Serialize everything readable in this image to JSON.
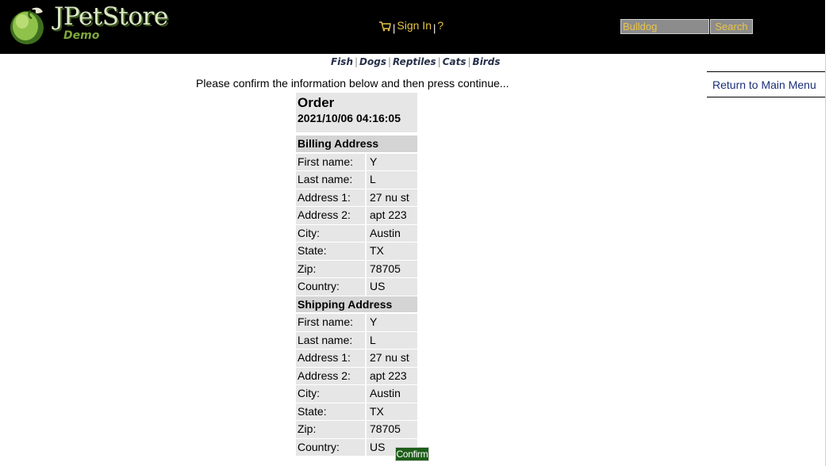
{
  "header": {
    "logo_title": "JPetStore",
    "logo_subtitle": "Demo",
    "sign_in": "Sign In",
    "help": "?",
    "search_value": "Bulldog",
    "search_button": "Search"
  },
  "quicklinks": [
    "Fish",
    "Dogs",
    "Reptiles",
    "Cats",
    "Birds"
  ],
  "return_link": "Return to Main Menu",
  "confirm_message": "Please confirm the information below and then press continue...",
  "order": {
    "title": "Order",
    "date": "2021/10/06 04:16:05",
    "billing_title": "Billing Address",
    "billing": [
      {
        "label": "First name:",
        "value": "Y"
      },
      {
        "label": "Last name:",
        "value": "L"
      },
      {
        "label": "Address 1:",
        "value": "27 nu st"
      },
      {
        "label": "Address 2:",
        "value": "apt 223"
      },
      {
        "label": "City:",
        "value": "Austin"
      },
      {
        "label": "State:",
        "value": "TX"
      },
      {
        "label": "Zip:",
        "value": "78705"
      },
      {
        "label": "Country:",
        "value": "US"
      }
    ],
    "shipping_title": "Shipping Address",
    "shipping": [
      {
        "label": "First name:",
        "value": "Y"
      },
      {
        "label": "Last name:",
        "value": "L"
      },
      {
        "label": "Address 1:",
        "value": "27 nu st"
      },
      {
        "label": "Address 2:",
        "value": "apt 223"
      },
      {
        "label": "City:",
        "value": "Austin"
      },
      {
        "label": "State:",
        "value": "TX"
      },
      {
        "label": "Zip:",
        "value": "78705"
      },
      {
        "label": "Country:",
        "value": "US"
      }
    ]
  },
  "confirm_button": "Confirm",
  "colors": {
    "header_bg": "#000000",
    "link_gold": "#e8c44a",
    "confirm_green": "#1e5e1a",
    "cell_gray": "#e6e6e6",
    "return_link_blue": "#1a2f7a"
  },
  "icons": [
    "parrot-logo-icon",
    "cart-icon"
  ]
}
